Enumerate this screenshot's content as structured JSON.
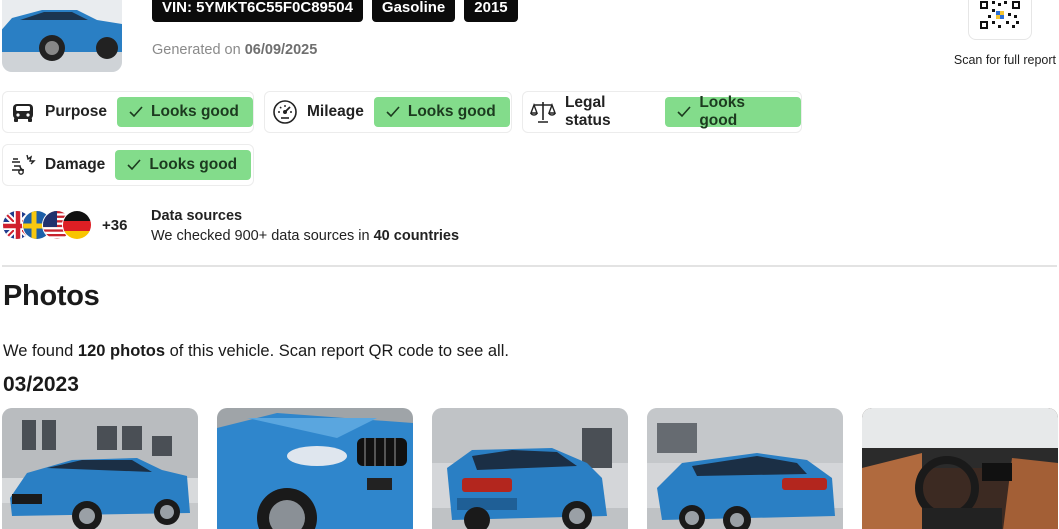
{
  "header": {
    "vin_tag": "VIN: 5YMKT6C55F0C89504",
    "fuel_tag": "Gasoline",
    "year_tag": "2015",
    "generated_prefix": "Generated on ",
    "generated_date": "06/09/2025",
    "qr_label": "Scan for full report",
    "car_thumb_icon": "car-photo"
  },
  "checks": [
    {
      "label": "Purpose",
      "status": "Looks good",
      "icon": "car-front-icon"
    },
    {
      "label": "Mileage",
      "status": "Looks good",
      "icon": "speedometer-icon"
    },
    {
      "label": "Legal status",
      "status": "Looks good",
      "icon": "scales-icon"
    },
    {
      "label": "Damage",
      "status": "Looks good",
      "icon": "crash-icon"
    }
  ],
  "data_sources": {
    "extra_count": "+36",
    "title": "Data sources",
    "text_prefix": "We checked 900+ data sources in ",
    "text_bold": "40 countries",
    "flags": [
      "uk-flag-icon",
      "sweden-flag-icon",
      "usa-flag-icon",
      "germany-flag-icon"
    ]
  },
  "photos": {
    "heading": "Photos",
    "found_prefix": "We found ",
    "found_bold": "120 photos",
    "found_suffix": " of this vehicle. Scan report QR code to see all.",
    "date": "03/2023",
    "items": [
      "front-left view",
      "front close-up",
      "rear-left view",
      "rear-left far view",
      "interior view"
    ]
  },
  "colors": {
    "badge_green": "#83dc8b",
    "tag_black": "#0b0b0b",
    "car_blue": "#2a7fc4"
  }
}
